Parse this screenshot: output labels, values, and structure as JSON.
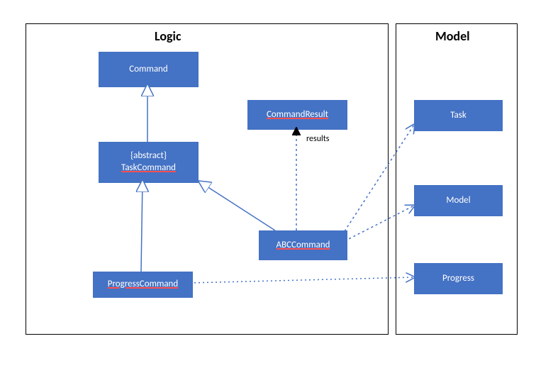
{
  "packages": {
    "logic": {
      "title": "Logic"
    },
    "model": {
      "title": "Model"
    }
  },
  "classes": {
    "command": {
      "label": "Command"
    },
    "task_command": {
      "stereotype": "{abstract}",
      "label": "TaskCommand"
    },
    "command_result": {
      "label": "CommandResult"
    },
    "abc_command": {
      "label": "ABCCommand"
    },
    "progress_command": {
      "label": "ProgressCommand"
    },
    "task": {
      "label": "Task"
    },
    "model_cls": {
      "label": "Model"
    },
    "progress": {
      "label": "Progress"
    }
  },
  "labels": {
    "results": "results"
  },
  "chart_data": {
    "type": "uml_class_diagram",
    "packages": [
      {
        "name": "Logic",
        "classes": [
          "Command",
          "TaskCommand",
          "CommandResult",
          "ABCCommand",
          "ProgressCommand"
        ]
      },
      {
        "name": "Model",
        "classes": [
          "Task",
          "Model",
          "Progress"
        ]
      }
    ],
    "classes": [
      {
        "name": "Command"
      },
      {
        "name": "TaskCommand",
        "abstract": true
      },
      {
        "name": "CommandResult"
      },
      {
        "name": "ABCCommand"
      },
      {
        "name": "ProgressCommand"
      },
      {
        "name": "Task"
      },
      {
        "name": "Model"
      },
      {
        "name": "Progress"
      }
    ],
    "relationships": [
      {
        "from": "TaskCommand",
        "to": "Command",
        "type": "generalization"
      },
      {
        "from": "ProgressCommand",
        "to": "TaskCommand",
        "type": "generalization"
      },
      {
        "from": "ABCCommand",
        "to": "TaskCommand",
        "type": "generalization"
      },
      {
        "from": "ABCCommand",
        "to": "CommandResult",
        "type": "dependency",
        "label": "results"
      },
      {
        "from": "ABCCommand",
        "to": "Task",
        "type": "dependency"
      },
      {
        "from": "ABCCommand",
        "to": "Model",
        "type": "dependency"
      },
      {
        "from": "ProgressCommand",
        "to": "Progress",
        "type": "dependency"
      }
    ]
  }
}
